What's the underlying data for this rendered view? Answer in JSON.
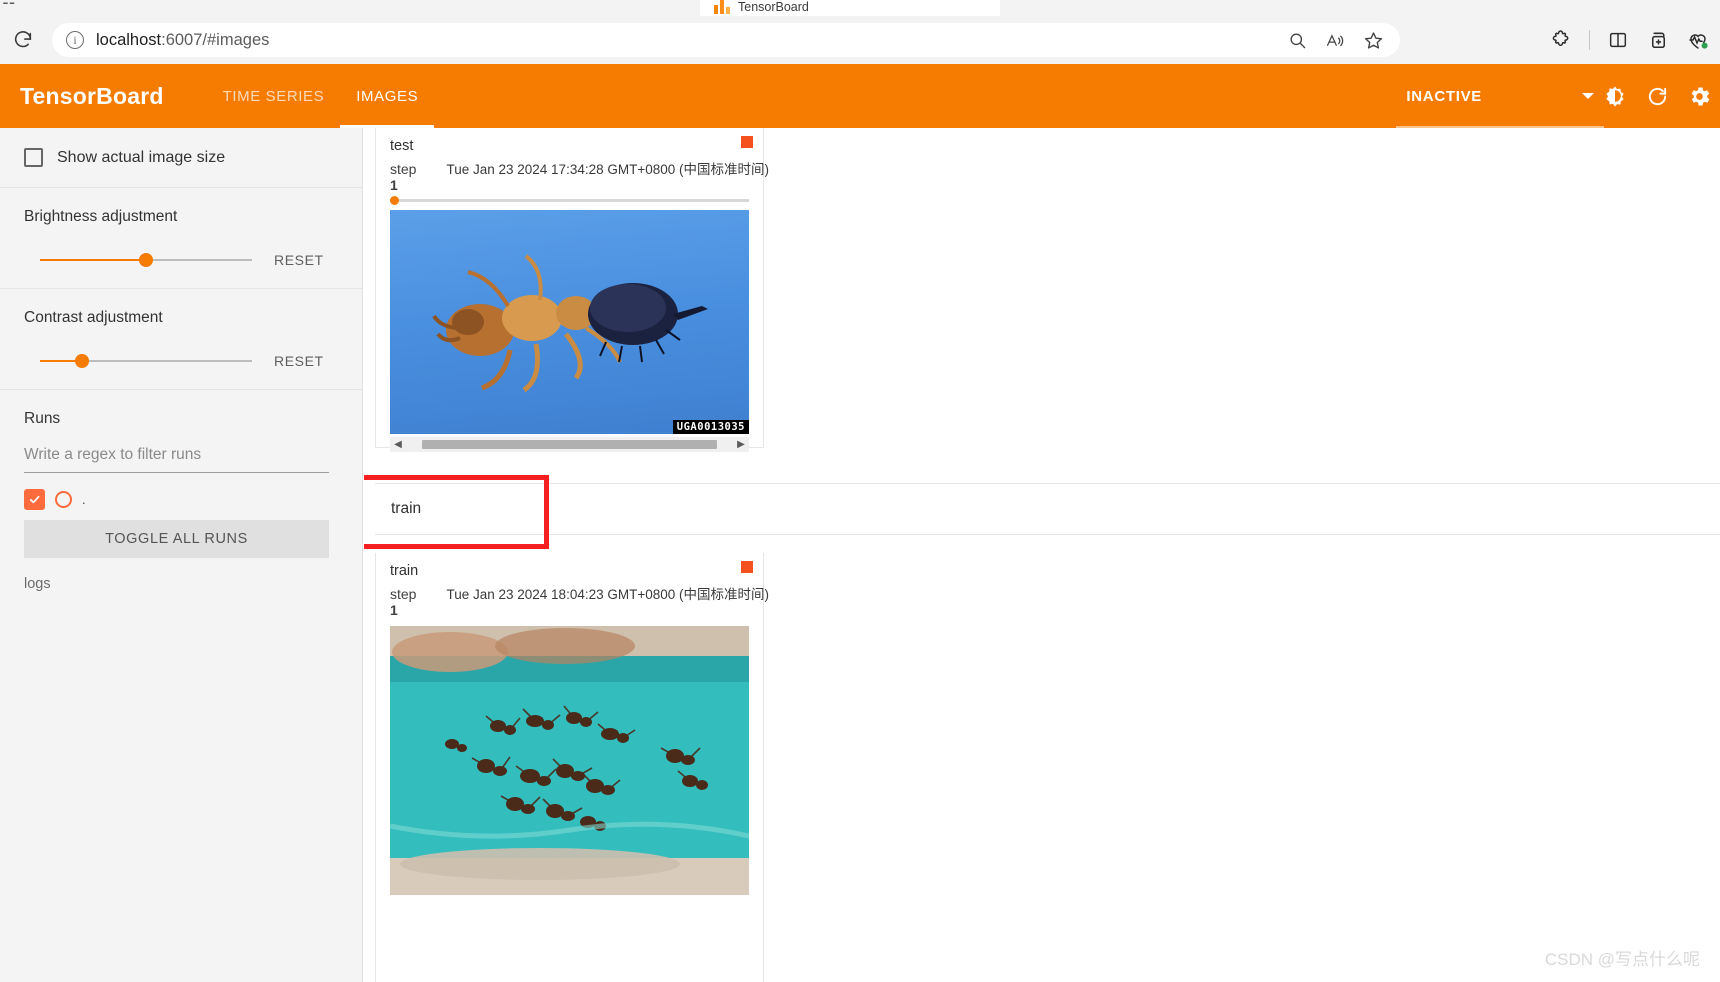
{
  "browser": {
    "tab_title": "TensorBoard",
    "url_prefix": "localhost",
    "url_suffix": ":6007/#images",
    "icons": {
      "reload": "reload-icon",
      "info": "info-icon",
      "zoom_out": "zoom-out-icon",
      "read_aloud": "read-aloud-icon",
      "favorite": "favorite-star-icon",
      "extensions": "extensions-puzzle-icon",
      "split_screen": "split-screen-icon",
      "add_collection": "add-to-collections-icon",
      "browser_essentials": "browser-essentials-icon"
    }
  },
  "header": {
    "brand": "TensorBoard",
    "tabs": [
      {
        "label": "TIME SERIES",
        "active": false
      },
      {
        "label": "IMAGES",
        "active": true
      }
    ],
    "status": "INACTIVE",
    "icons": {
      "dropdown": "chevron-down-icon",
      "brightness": "brightness-icon",
      "refresh": "refresh-icon",
      "settings": "gear-icon"
    },
    "accent_color": "#f57c00"
  },
  "sidebar": {
    "show_actual_size": {
      "label": "Show actual image size",
      "checked": false
    },
    "brightness": {
      "label": "Brightness adjustment",
      "reset_label": "RESET",
      "value_percent": 50
    },
    "contrast": {
      "label": "Contrast adjustment",
      "reset_label": "RESET",
      "value_percent": 20
    },
    "runs": {
      "label": "Runs",
      "filter_placeholder": "Write a regex to filter runs",
      "filter_value": "",
      "items": [
        {
          "name": ".",
          "checked": true,
          "color": "#ff6b3d"
        }
      ],
      "toggle_all_label": "TOGGLE ALL RUNS",
      "logs_label": "logs"
    }
  },
  "main": {
    "cards": [
      {
        "tag": "test",
        "step_label": "step",
        "step_value": "1",
        "date": "Tue Jan 23 2024 17:34:28 GMT+0800 (中国标准时间)",
        "image_watermark": "UGA0013035",
        "has_scrollbar": true
      },
      {
        "tag": "train",
        "step_label": "step",
        "step_value": "1",
        "date": "Tue Jan 23 2024 18:04:23 GMT+0800 (中国标准时间)",
        "image_watermark": "",
        "has_scrollbar": false
      }
    ],
    "section_header": {
      "label": "train",
      "highlighted": true,
      "highlight_color": "#f42020"
    }
  },
  "page_watermark": "CSDN @写点什么呢"
}
